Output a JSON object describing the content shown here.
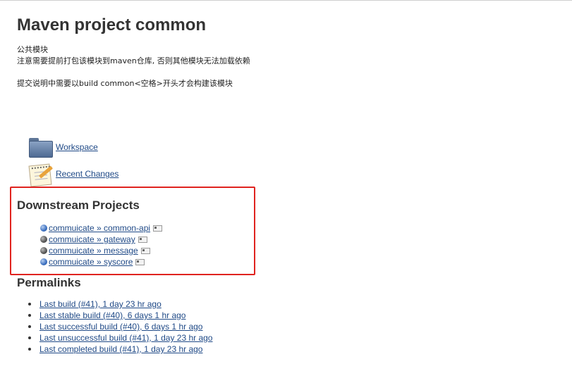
{
  "page": {
    "title": "Maven project common",
    "description": {
      "line1": "公共模块",
      "line2": "注意需要提前打包该模块到maven仓库, 否则其他模块无法加载依赖",
      "line3": "提交说明中需要以build common<空格>开头才会构建该模块"
    }
  },
  "tasks": [
    {
      "label": "Workspace",
      "icon": "folder-icon"
    },
    {
      "label": "Recent Changes",
      "icon": "notepad-icon"
    }
  ],
  "downstream": {
    "title": "Downstream Projects",
    "projects": [
      {
        "label": "commuicate » common-api",
        "status": "blue"
      },
      {
        "label": "commuicate » gateway",
        "status": "grey"
      },
      {
        "label": "commuicate » message",
        "status": "grey"
      },
      {
        "label": "commuicate » syscore",
        "status": "blue"
      }
    ]
  },
  "permalinks": {
    "title": "Permalinks",
    "items": [
      "Last build (#41), 1 day 23 hr ago",
      "Last stable build (#40), 6 days 1 hr ago",
      "Last successful build (#40), 6 days 1 hr ago",
      "Last unsuccessful build (#41), 1 day 23 hr ago",
      "Last completed build (#41), 1 day 23 hr ago"
    ]
  },
  "colors": {
    "link": "#204a87",
    "highlight_box": "#e0231f",
    "status_blue": "#3a6fc0",
    "status_grey": "#555555"
  }
}
